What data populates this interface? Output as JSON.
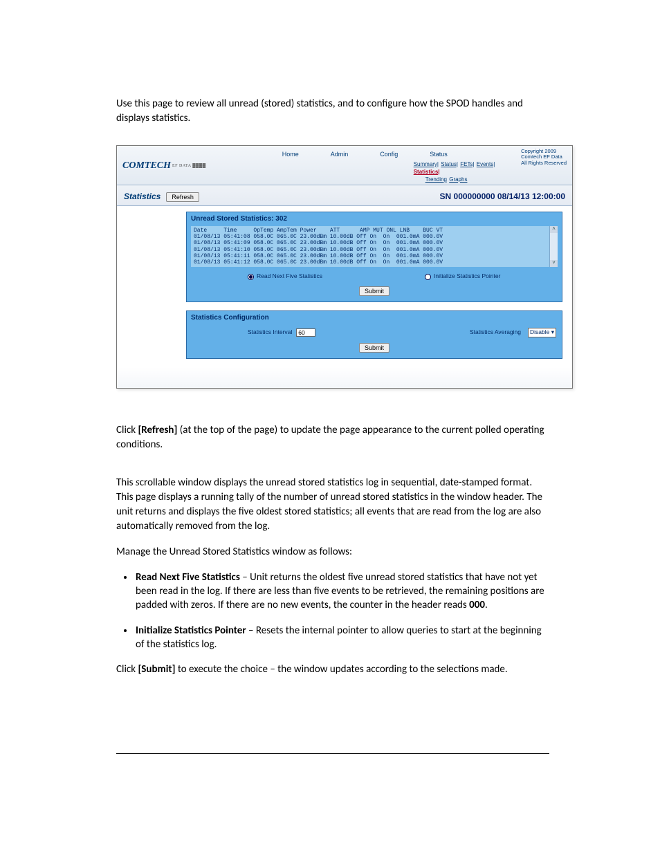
{
  "intro": "Use this page to review all unread (stored) statistics, and to configure how the SPOD handles and displays statistics.",
  "shot": {
    "logo": "COMTECH",
    "logo_sub": "EF DATA ▓▓▓▓",
    "topnav": [
      "Home",
      "Admin",
      "Config",
      "Status"
    ],
    "subnav": {
      "Summary": "Summary|",
      "Status": "Status|",
      "FETs": "FETs|",
      "Events": "Events|",
      "Statistics": "Statistics|",
      "Trending": "Trending",
      "Graphs": "Graphs"
    },
    "copyright": [
      "Copyright 2009",
      "Comtech EF Data",
      "All Rights Reserved"
    ],
    "page_title": "Statistics",
    "refresh_label": "Refresh",
    "sn_text": "SN 000000000 08/14/13 12:00:00",
    "unread_header": "Unread Stored Statistics: 302",
    "log_header": "Date     Time     OpTemp AmpTem Power    ATT      AMP MUT ONL LNB    BUC VT",
    "log_lines": [
      "01/08/13 05:41:08 058.0C 065.0C 23.00dBm 10.00dB Off On  On  001.0mA 000.0V",
      "01/08/13 05:41:09 058.0C 065.0C 23.00dBm 10.00dB Off On  On  001.0mA 000.0V",
      "01/08/13 05:41:10 058.0C 065.0C 23.00dBm 10.00dB Off On  On  001.0mA 000.0V",
      "01/08/13 05:41:11 058.0C 065.0C 23.00dBm 10.00dB Off On  On  001.0mA 000.0V",
      "01/08/13 05:41:12 058.0C 065.0C 23.00dBm 10.00dB Off On  On  001.0mA 000.0V"
    ],
    "read_next_label": "Read Next Five Statistics",
    "init_ptr_label": "Initialize Statistics Pointer",
    "submit_label": "Submit",
    "stats_cfg_header": "Statistics Configuration",
    "interval_label": "Statistics Interval",
    "interval_value": "60",
    "averaging_label": "Statistics Averaging",
    "averaging_value": "Disable ▾"
  },
  "para_refresh_pre": "Click ",
  "para_refresh_b": "[Refresh]",
  "para_refresh_post": " (at the top of the page) to update the page appearance to the current polled operating conditions.",
  "para_scroll_pre": "This ",
  "para_scroll_i": "s",
  "para_scroll_post": "crollable window displays the unread stored statistics log in sequential, date-stamped format. This page displays a running tally of the number of unread stored statistics in the window header. The unit returns and displays the five oldest stored statistics; all events that are read from the log are also automatically removed from the log.",
  "para_manage": "Manage the Unread Stored Statistics window as follows:",
  "bullet1_b": "Read Next Five Statistics",
  "bullet1_rest": " – Unit returns the oldest five unread stored statistics that have not yet been read in the log. If there are less than five events to be retrieved, the remaining positions are padded with zeros. If there are no new events, the counter in the header reads ",
  "bullet1_end_b": "000",
  "bullet2_b": "Initialize Statistics Pointer",
  "bullet2_rest": " – Resets the internal pointer to allow queries to start at the beginning of the statistics log.",
  "para_submit_pre": "Click ",
  "para_submit_b": "[Submit]",
  "para_submit_post": " to execute the choice – the window updates according to the selections made."
}
